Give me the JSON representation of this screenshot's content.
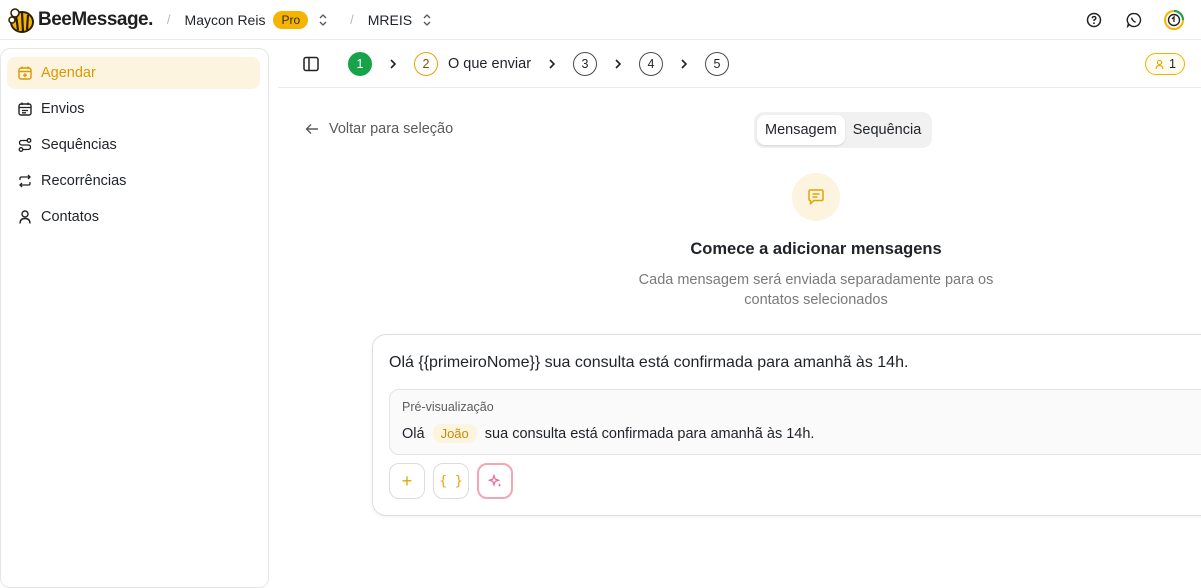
{
  "header": {
    "brand": "BeeMessage",
    "brand_mark": ".",
    "crumbs": {
      "user": "Maycon Reis",
      "plan_badge": "Pro",
      "workspace": "MREIS"
    },
    "icons": [
      "help-icon",
      "whatsapp-icon",
      "profile-progress-icon"
    ]
  },
  "sidebar": {
    "items": [
      {
        "label": "Agendar",
        "icon": "calendar-plus-icon",
        "active": true
      },
      {
        "label": "Envios",
        "icon": "calendar-icon",
        "active": false
      },
      {
        "label": "Sequências",
        "icon": "route-icon",
        "active": false
      },
      {
        "label": "Recorrências",
        "icon": "repeat-icon",
        "active": false
      },
      {
        "label": "Contatos",
        "icon": "user-icon",
        "active": false
      }
    ]
  },
  "stepper": {
    "steps": [
      {
        "number": "1",
        "state": "done",
        "label": ""
      },
      {
        "number": "2",
        "state": "current",
        "label": "O que enviar"
      },
      {
        "number": "3",
        "state": "todo",
        "label": ""
      },
      {
        "number": "4",
        "state": "todo",
        "label": ""
      },
      {
        "number": "5",
        "state": "todo",
        "label": ""
      }
    ],
    "contacts_count": "1"
  },
  "main": {
    "back_label": "Voltar para seleção",
    "tabs": {
      "message": "Mensagem",
      "sequence": "Sequência",
      "active": "Mensagem"
    },
    "empty_state": {
      "title": "Comece a adicionar mensagens",
      "description": "Cada mensagem será enviada separadamente para os contatos selecionados"
    },
    "message_card": {
      "text": "Olá {{primeiroNome}} sua consulta está confirmada para amanhã às 14h.",
      "preview_label": "Pré-visualização",
      "preview_prefix": "Olá",
      "preview_variable": "João",
      "preview_suffix": "sua consulta está confirmada para amanhã às 14h.",
      "tools": {
        "add": "+",
        "variable": "{ }"
      }
    }
  },
  "colors": {
    "accent": "#F5B400",
    "step_done": "#17A34A",
    "active_nav_bg": "#FDF4E0"
  }
}
